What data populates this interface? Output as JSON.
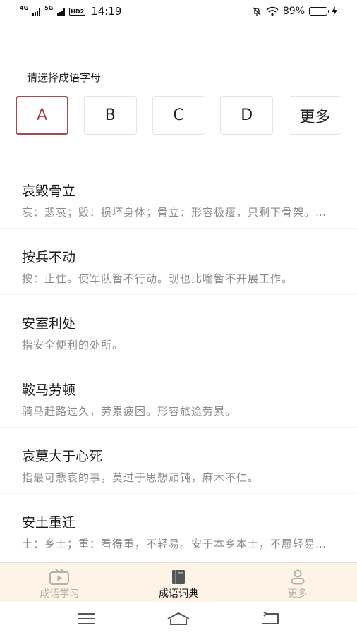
{
  "status": {
    "net1": "4G",
    "net2": "5G",
    "hd": "HD2",
    "time": "14:19",
    "battery": "89%",
    "battery_level": 0.89
  },
  "prompt": "请选择成语字母",
  "letters": [
    {
      "label": "A",
      "active": true
    },
    {
      "label": "B",
      "active": false
    },
    {
      "label": "C",
      "active": false
    },
    {
      "label": "D",
      "active": false
    },
    {
      "label": "更多",
      "active": false
    }
  ],
  "idioms": [
    {
      "title": "哀毁骨立",
      "desc": "哀：悲哀；毁：损坏身体；骨立：形容极瘦，只剩下骨架。旧时形容在父母丧中因过度悲伤而瘦得不成样子。"
    },
    {
      "title": "按兵不动",
      "desc": "按：止住。使军队暂不行动。现也比喻暂不开展工作。"
    },
    {
      "title": "安室利处",
      "desc": "指安全便利的处所。"
    },
    {
      "title": "鞍马劳顿",
      "desc": "骑马赶路过久，劳累疲困。形容旅途劳累。"
    },
    {
      "title": "哀莫大于心死",
      "desc": "指最可悲哀的事，莫过于思想顽钝，麻木不仁。"
    },
    {
      "title": "安土重迁",
      "desc": "土：乡土；重：看得重，不轻易。安于本乡本土，不愿轻易迁移。"
    }
  ],
  "tabs": [
    {
      "label": "成语学习",
      "icon": "tv-icon",
      "active": false
    },
    {
      "label": "成语词典",
      "icon": "book-icon",
      "active": true
    },
    {
      "label": "更多",
      "icon": "person-icon",
      "active": false
    }
  ],
  "colors": {
    "accent": "#a8474f",
    "tabbar_bg": "#fdf3e6",
    "tab_inactive": "#b8b0a6"
  }
}
